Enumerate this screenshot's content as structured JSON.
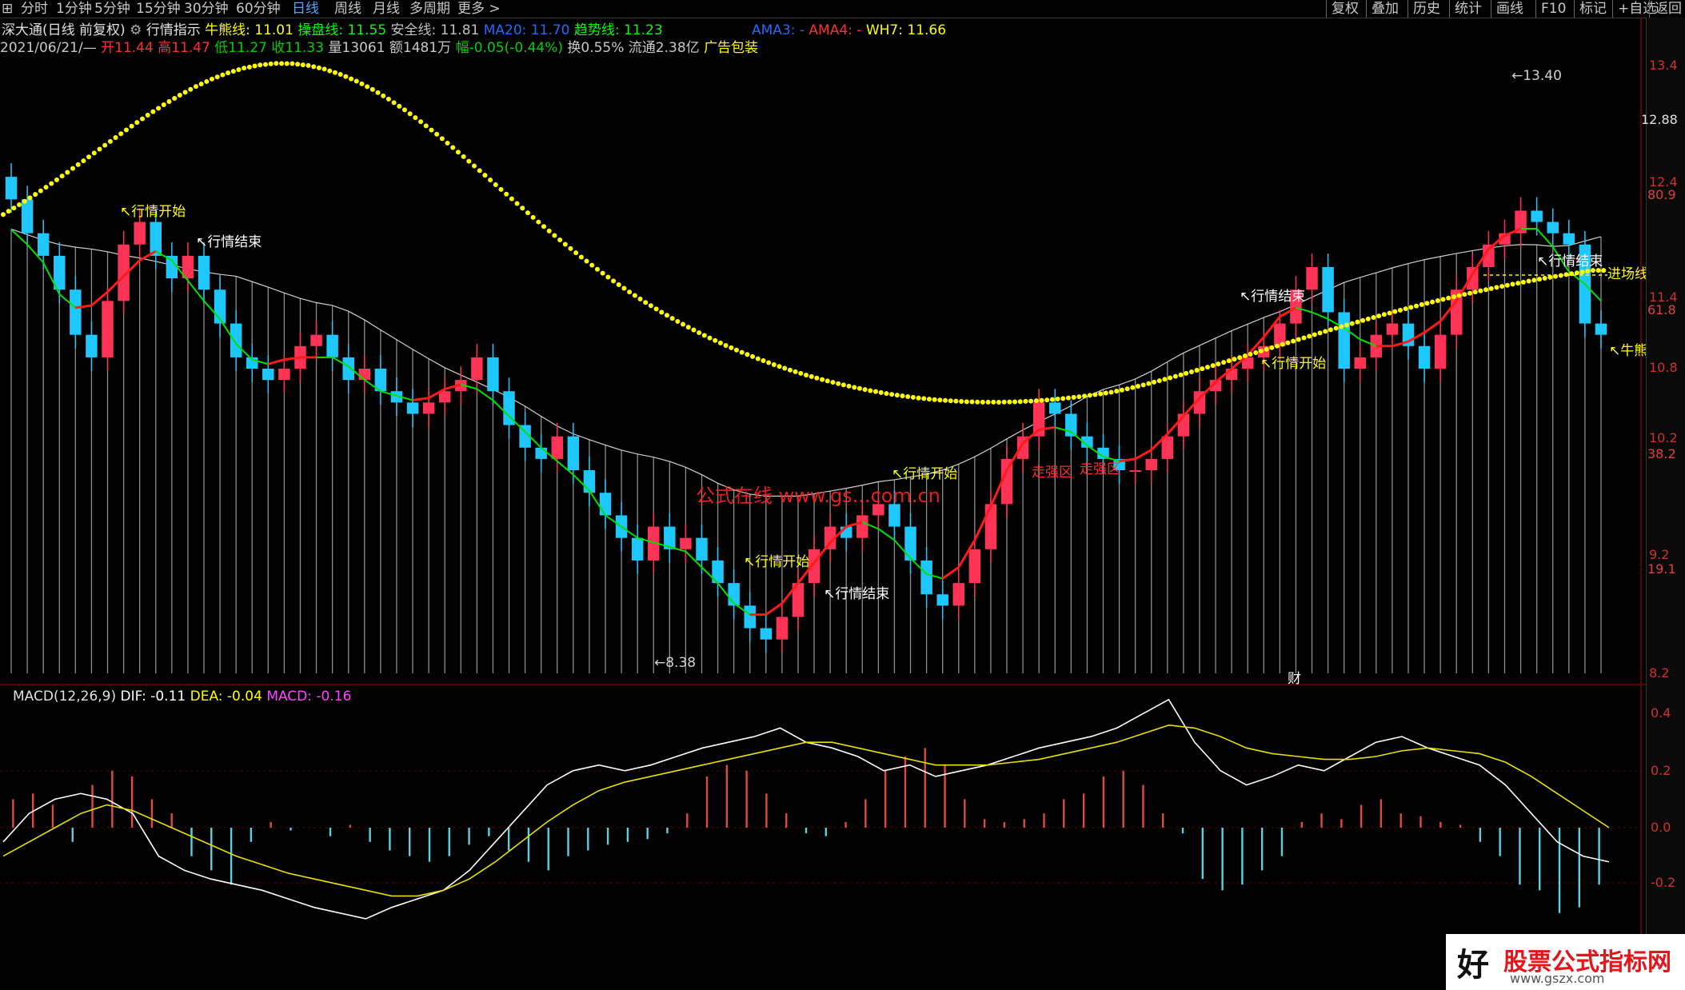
{
  "toolbar": {
    "icon": "grid-icon",
    "tabs": [
      "分时",
      "1分钟",
      "5分钟",
      "15分钟",
      "30分钟",
      "60分钟",
      "日线",
      "周线",
      "月线",
      "多周期",
      "更多 >"
    ],
    "active_tab": "日线",
    "right_buttons": [
      "复权",
      "叠加",
      "历史",
      "统计",
      "画线",
      "F10",
      "标记",
      "+自选",
      "返回"
    ]
  },
  "header": {
    "title": "深大通(日线 前复权)",
    "indicator": "行情指示",
    "items": [
      {
        "text": "牛熊线: 11.01",
        "color": "#ffff00"
      },
      {
        "text": "操盘线: 11.55",
        "color": "#00ff00"
      },
      {
        "text": "安全线: 11.81",
        "color": "#c0c0c0"
      },
      {
        "text": "MA20: 11.70",
        "color": "#1e6bff"
      },
      {
        "text": "趋势线: 11.23",
        "color": "#00ff00"
      }
    ],
    "items2": [
      {
        "text": "AMA3: -",
        "color": "#1e6bff"
      },
      {
        "text": "AMA4: -",
        "color": "#ff3030"
      },
      {
        "text": "WH7: 11.66",
        "color": "#ffff00"
      }
    ],
    "ohlc": [
      {
        "text": "2021/06/21/—",
        "color": "#c8c8c8"
      },
      {
        "text": "开11.44",
        "color": "#ff3030"
      },
      {
        "text": "高11.47",
        "color": "#ff3030"
      },
      {
        "text": "低11.27",
        "color": "#00d000"
      },
      {
        "text": "收11.33",
        "color": "#00d000"
      },
      {
        "text": "量13061",
        "color": "#c8c8c8"
      },
      {
        "text": "额1481万",
        "color": "#c8c8c8"
      },
      {
        "text": "幅-0.05(-0.44%)",
        "color": "#00d000"
      },
      {
        "text": "换0.55% 流通2.38亿",
        "color": "#c8c8c8"
      },
      {
        "text": "广告包装",
        "color": "#ffff00"
      }
    ]
  },
  "price_axis": [
    "13.4",
    "12.88",
    "12.4",
    "11.4",
    "10.8",
    "10.2",
    "9.2",
    "8.2"
  ],
  "pct_axis": [
    "80.9",
    "61.8",
    "38.2",
    "19.1"
  ],
  "macd_axis": [
    "0.4",
    "0.2",
    "0.0",
    "-0.2"
  ],
  "annotations": {
    "high": "13.40",
    "low": "8.38",
    "start": "行情开始",
    "end": "行情结束",
    "entry": "进场线",
    "bear": "牛熊线",
    "zone": "走强区",
    "cai": "财"
  },
  "watermark_center": "公式在线  www.gs...com.cn",
  "macd_header": {
    "name": "MACD(12,26,9)",
    "dif": "DIF: -0.11",
    "dea": "DEA: -0.04",
    "macd": "MACD: -0.16"
  },
  "watermark": {
    "big": "好",
    "red": "股票公式指标网",
    "url": "www.gszx.com"
  },
  "colors": {
    "up": "#ff3355",
    "down": "#1ec8ff",
    "ma": "#00e000",
    "bull": "#ffff00",
    "envelope": "#bdbdbd"
  },
  "chart_data": {
    "type": "candlestick",
    "x_count": 100,
    "ylim": [
      8.2,
      13.6
    ],
    "closes": [
      12.4,
      12.1,
      11.9,
      11.6,
      11.2,
      11.0,
      11.5,
      12.0,
      12.2,
      11.9,
      11.7,
      11.9,
      11.6,
      11.3,
      11.0,
      10.9,
      10.8,
      10.9,
      11.1,
      11.2,
      11.0,
      10.8,
      10.9,
      10.7,
      10.6,
      10.5,
      10.6,
      10.7,
      10.8,
      11.0,
      10.7,
      10.4,
      10.2,
      10.1,
      10.3,
      10.0,
      9.8,
      9.6,
      9.4,
      9.2,
      9.5,
      9.3,
      9.4,
      9.2,
      9.0,
      8.8,
      8.6,
      8.5,
      8.7,
      9.0,
      9.3,
      9.5,
      9.4,
      9.6,
      9.7,
      9.5,
      9.2,
      8.9,
      8.8,
      9.0,
      9.3,
      9.7,
      10.1,
      10.3,
      10.6,
      10.5,
      10.3,
      10.2,
      10.1,
      10.0,
      10.0,
      10.1,
      10.3,
      10.5,
      10.7,
      10.8,
      10.9,
      11.0,
      11.1,
      11.3,
      11.6,
      11.8,
      11.4,
      10.9,
      11.0,
      11.2,
      11.3,
      11.1,
      10.9,
      11.2,
      11.6,
      11.8,
      12.0,
      12.1,
      12.3,
      12.2,
      12.1,
      12.0,
      11.3,
      11.2
    ],
    "macd_hist": [
      0.1,
      0.12,
      0.08,
      -0.05,
      0.15,
      0.2,
      0.18,
      0.1,
      0.05,
      -0.1,
      -0.15,
      -0.2,
      -0.05,
      0.02,
      -0.01,
      0,
      -0.03,
      0.01,
      -0.05,
      -0.08,
      -0.1,
      -0.12,
      -0.1,
      -0.06,
      -0.03,
      -0.08,
      -0.12,
      -0.15,
      -0.1,
      -0.08,
      -0.06,
      -0.05,
      -0.04,
      -0.02,
      0.05,
      0.18,
      0.22,
      0.2,
      0.12,
      0.05,
      -0.02,
      -0.03,
      0.02,
      0.1,
      0.2,
      0.25,
      0.28,
      0.22,
      0.1,
      0.03,
      0.02,
      0.03,
      0.05,
      0.1,
      0.12,
      0.18,
      0.2,
      0.15,
      0.05,
      -0.02,
      -0.18,
      -0.22,
      -0.2,
      -0.15,
      -0.1,
      0.02,
      0.05,
      0.03,
      0.08,
      0.1,
      0.05,
      0.04,
      0.02,
      0.01,
      -0.05,
      -0.1,
      -0.2,
      -0.22,
      -0.3,
      -0.28,
      -0.2
    ],
    "dif": [
      -0.05,
      0.05,
      0.1,
      0.12,
      0.1,
      0.05,
      -0.1,
      -0.15,
      -0.18,
      -0.2,
      -0.22,
      -0.25,
      -0.28,
      -0.3,
      -0.32,
      -0.28,
      -0.25,
      -0.22,
      -0.15,
      -0.05,
      0.05,
      0.15,
      0.2,
      0.22,
      0.2,
      0.22,
      0.25,
      0.28,
      0.3,
      0.32,
      0.35,
      0.3,
      0.28,
      0.25,
      0.2,
      0.22,
      0.18,
      0.2,
      0.22,
      0.25,
      0.28,
      0.3,
      0.32,
      0.35,
      0.4,
      0.45,
      0.3,
      0.2,
      0.15,
      0.18,
      0.22,
      0.2,
      0.25,
      0.3,
      0.32,
      0.28,
      0.25,
      0.22,
      0.15,
      0.05,
      -0.05,
      -0.1,
      -0.12
    ],
    "dea": [
      -0.1,
      -0.05,
      0.0,
      0.05,
      0.08,
      0.06,
      0.02,
      -0.02,
      -0.06,
      -0.1,
      -0.13,
      -0.16,
      -0.18,
      -0.2,
      -0.22,
      -0.24,
      -0.24,
      -0.22,
      -0.18,
      -0.12,
      -0.05,
      0.02,
      0.08,
      0.13,
      0.16,
      0.18,
      0.2,
      0.22,
      0.24,
      0.26,
      0.28,
      0.3,
      0.3,
      0.28,
      0.26,
      0.24,
      0.22,
      0.22,
      0.22,
      0.23,
      0.24,
      0.26,
      0.28,
      0.3,
      0.33,
      0.36,
      0.35,
      0.32,
      0.28,
      0.26,
      0.25,
      0.24,
      0.24,
      0.25,
      0.27,
      0.28,
      0.27,
      0.26,
      0.23,
      0.18,
      0.12,
      0.06,
      0.0
    ]
  }
}
